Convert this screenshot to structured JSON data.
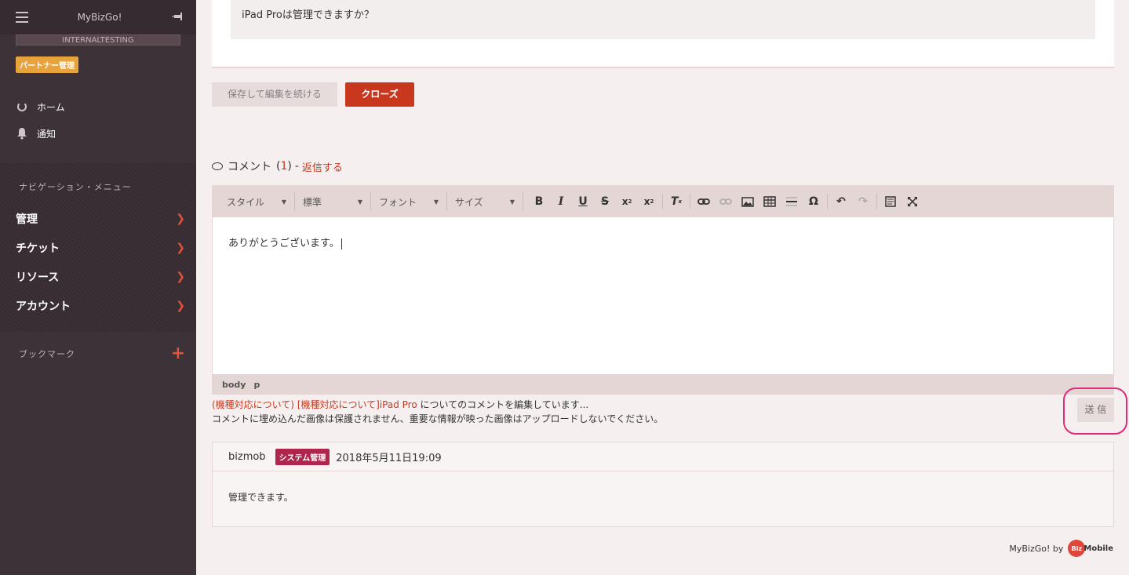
{
  "sidebar": {
    "app_title": "MyBizGo!",
    "environment": "INTERNALTESTING",
    "role_badge": "パートナー管理",
    "quick_links": [
      {
        "label": "ホーム",
        "icon": "home-ring-icon"
      },
      {
        "label": "通知",
        "icon": "bell-icon"
      }
    ],
    "nav_heading": "ナビゲーション・メニュー",
    "nav_items": [
      {
        "label": "管理"
      },
      {
        "label": "チケット"
      },
      {
        "label": "リソース"
      },
      {
        "label": "アカウント"
      }
    ],
    "bookmarks_label": "ブックマーク"
  },
  "question": {
    "text": "iPad Proは管理できますか？"
  },
  "actions": {
    "save_continue": "保存して編集を続ける",
    "close": "クローズ"
  },
  "comments": {
    "label": "コメント",
    "count_open": "(",
    "count": "1",
    "count_close": ")",
    "separator": "-",
    "reply": "返信する"
  },
  "editor": {
    "style_select": "スタイル",
    "format_select": "標準",
    "font_select": "フォント",
    "size_select": "サイズ",
    "content": "ありがとうございます。",
    "path": [
      "body",
      "p"
    ]
  },
  "note": {
    "ticket_ref": "(機種対応について) [機種対応について]iPad Pro",
    "editing_text": " についてのコメントを編集しています...",
    "warning": "コメントに埋め込んだ画像は保護されません、重要な情報が映った画像はアップロードしないでください。"
  },
  "send_button": "送 信",
  "comment": {
    "author": "bizmob",
    "role": "システム管理",
    "timestamp": "2018年5月11日19:09",
    "body": "管理できます。"
  },
  "footer": {
    "text": "MyBizGo! by",
    "logo_dot": "Biz",
    "logo_text": "Mobile"
  },
  "colors": {
    "sidebar_bg": "#3e3239",
    "accent_red": "#c8381f",
    "badge_orange": "#e8a33c",
    "role_badge": "#b0254d",
    "highlight_ring": "#e02a7a"
  }
}
